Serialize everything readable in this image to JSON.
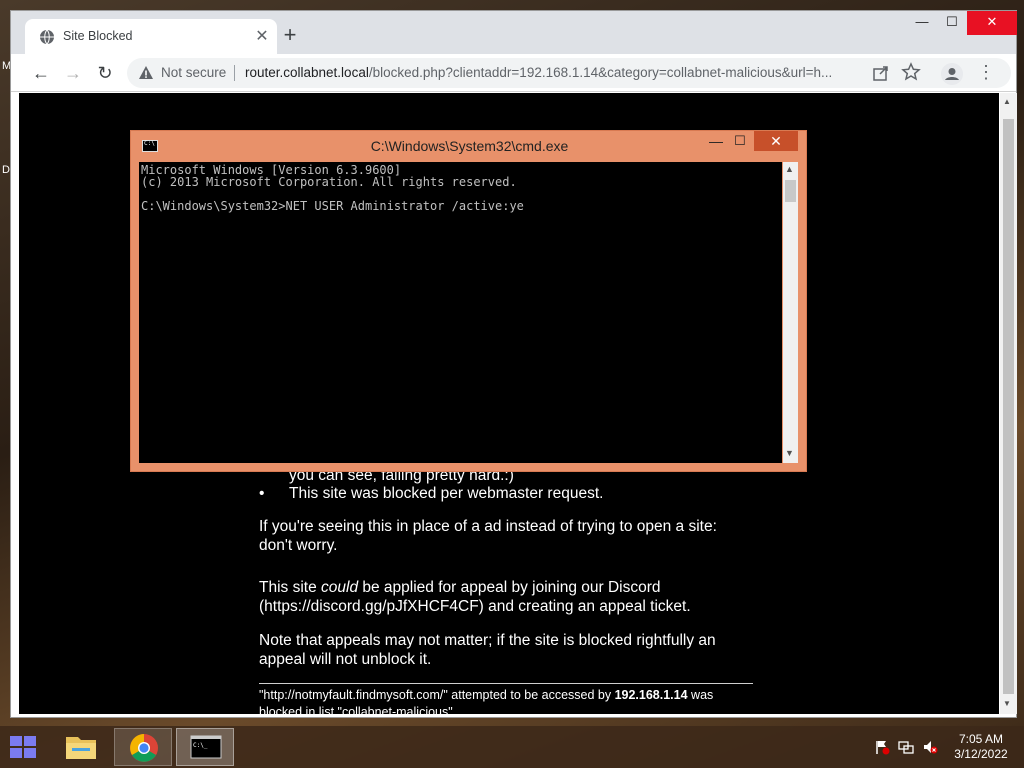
{
  "desktop": {
    "edge_letter_1": "M",
    "edge_letter_2": "D"
  },
  "browser": {
    "tab": {
      "title": "Site Blocked",
      "close": "✕"
    },
    "new_tab": "+",
    "window_controls": {
      "minimize": "—",
      "maximize": "☐",
      "close": "✕"
    },
    "nav": {
      "back": "←",
      "forward": "→",
      "reload": "↻"
    },
    "omnibox": {
      "security_label": "Not secure",
      "url_host": "router.collabnet.local",
      "url_rest": "/blocked.php?clientaddr=192.168.1.14&category=collabnet-malicious&url=h..."
    },
    "menu": "⋮"
  },
  "page": {
    "cut_text": "you can see, failing pretty hard.:)",
    "bullet": "This site was blocked per webmaster request.",
    "para1": "If you're seeing this in place of a ad instead of trying to open a site: don't worry.",
    "para2_prefix": "This site ",
    "para2_em": "could",
    "para2_suffix": " be applied for appeal by joining our Discord (https://discord.gg/pJfXHCF4CF) and creating an appeal ticket.",
    "para3": "Note that appeals may not matter; if the site is blocked rightfully an appeal will not unblock it.",
    "footer_prefix": "\"http://notmyfault.findmysoft.com/\" attempted to be accessed by ",
    "footer_ip": "192.168.1.14",
    "footer_suffix": " was blocked in list \"collabnet-malicious\"."
  },
  "cmd": {
    "title": "C:\\Windows\\System32\\cmd.exe",
    "controls": {
      "minimize": "—",
      "maximize": "☐",
      "close": "✕"
    },
    "lines": [
      "Microsoft Windows [Version 6.3.9600]",
      "(c) 2013 Microsoft Corporation. All rights reserved.",
      "",
      "C:\\Windows\\System32>NET USER Administrator /active:ye"
    ]
  },
  "taskbar": {
    "clock_time": "7:05 AM",
    "clock_date": "3/12/2022"
  },
  "colors": {
    "cmd_frame": "#e8916a",
    "cmd_close": "#c7502a",
    "chrome_close": "#e81123"
  }
}
